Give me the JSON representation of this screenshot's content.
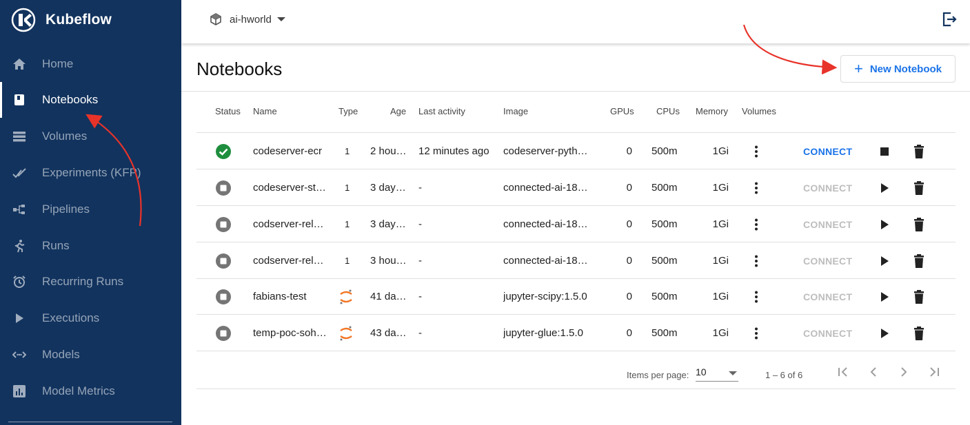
{
  "app": {
    "name": "Kubeflow"
  },
  "sidebar": {
    "items": [
      {
        "label": "Home",
        "icon": "home-icon"
      },
      {
        "label": "Notebooks",
        "icon": "notebook-icon",
        "active": true
      },
      {
        "label": "Volumes",
        "icon": "volumes-icon"
      },
      {
        "label": "Experiments (KFP)",
        "icon": "experiments-icon"
      },
      {
        "label": "Pipelines",
        "icon": "pipelines-icon"
      },
      {
        "label": "Runs",
        "icon": "runs-icon"
      },
      {
        "label": "Recurring Runs",
        "icon": "alarm-icon"
      },
      {
        "label": "Executions",
        "icon": "play-icon"
      },
      {
        "label": "Models",
        "icon": "models-icon"
      },
      {
        "label": "Model Metrics",
        "icon": "metrics-icon"
      }
    ]
  },
  "topbar": {
    "namespace": "ai-hworld"
  },
  "page": {
    "title": "Notebooks",
    "new_button_label": "New Notebook"
  },
  "table": {
    "columns": [
      "Status",
      "Name",
      "Type",
      "Age",
      "Last activity",
      "Image",
      "GPUs",
      "CPUs",
      "Memory",
      "Volumes"
    ],
    "rows": [
      {
        "status": "running",
        "name": "codeserver-ecr",
        "type": "1",
        "age": "2 hou…",
        "last_activity": "12 minutes ago",
        "image": "codeserver-pyth…",
        "gpus": "0",
        "cpus": "500m",
        "memory": "1Gi",
        "connect": "CONNECT",
        "connect_enabled": true,
        "action": "stop"
      },
      {
        "status": "stopped",
        "name": "codeserver-st…",
        "type": "1",
        "age": "3 day…",
        "last_activity": "-",
        "image": "connected-ai-18…",
        "gpus": "0",
        "cpus": "500m",
        "memory": "1Gi",
        "connect": "CONNECT",
        "connect_enabled": false,
        "action": "start"
      },
      {
        "status": "stopped",
        "name": "codserver-rel…",
        "type": "1",
        "age": "3 day…",
        "last_activity": "-",
        "image": "connected-ai-18…",
        "gpus": "0",
        "cpus": "500m",
        "memory": "1Gi",
        "connect": "CONNECT",
        "connect_enabled": false,
        "action": "start"
      },
      {
        "status": "stopped",
        "name": "codserver-rel…",
        "type": "1",
        "age": "3 hou…",
        "last_activity": "-",
        "image": "connected-ai-18…",
        "gpus": "0",
        "cpus": "500m",
        "memory": "1Gi",
        "connect": "CONNECT",
        "connect_enabled": false,
        "action": "start"
      },
      {
        "status": "stopped",
        "name": "fabians-test",
        "type": "jupyter",
        "age": "41 da…",
        "last_activity": "-",
        "image": "jupyter-scipy:1.5.0",
        "gpus": "0",
        "cpus": "500m",
        "memory": "1Gi",
        "connect": "CONNECT",
        "connect_enabled": false,
        "action": "start"
      },
      {
        "status": "stopped",
        "name": "temp-poc-soh…",
        "type": "jupyter",
        "age": "43 da…",
        "last_activity": "-",
        "image": "jupyter-glue:1.5.0",
        "gpus": "0",
        "cpus": "500m",
        "memory": "1Gi",
        "connect": "CONNECT",
        "connect_enabled": false,
        "action": "start"
      }
    ]
  },
  "pagination": {
    "items_per_page_label": "Items per page:",
    "items_per_page": "10",
    "range": "1 – 6 of 6"
  },
  "colors": {
    "sidebar_bg": "#12335e",
    "accent": "#1a73e8",
    "running": "#1e8e3e",
    "stopped": "#757575",
    "annotation_arrow": "#e8332a"
  }
}
